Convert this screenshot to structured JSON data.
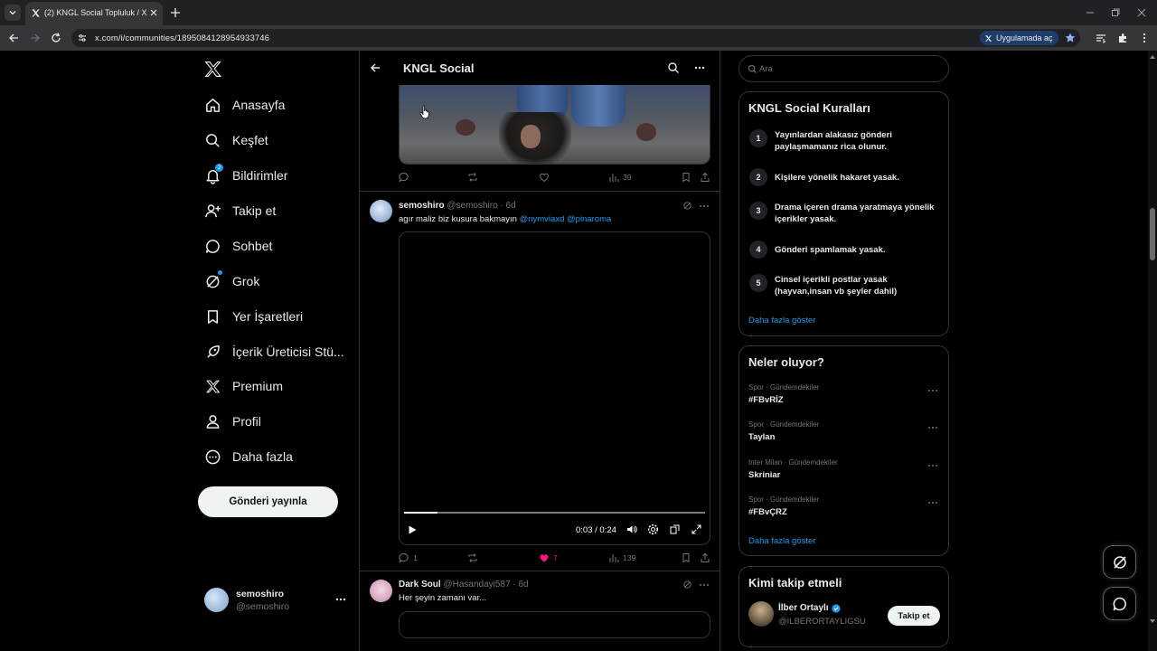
{
  "browser": {
    "tab_title": "(2) KNGL Social Topluluk / X",
    "url": "x.com/i/communities/1895084128954933746",
    "app_open_label": "Uygulamada aç"
  },
  "nav": {
    "items": [
      {
        "label": "Anasayfa",
        "icon": "home-icon"
      },
      {
        "label": "Keşfet",
        "icon": "search-icon"
      },
      {
        "label": "Bildirimler",
        "icon": "bell-icon",
        "badge": "2"
      },
      {
        "label": "Takip et",
        "icon": "add-person-icon"
      },
      {
        "label": "Sohbet",
        "icon": "chat-icon"
      },
      {
        "label": "Grok",
        "icon": "grok-icon"
      },
      {
        "label": "Yer İşaretleri",
        "icon": "bookmark-icon"
      },
      {
        "label": "İçerik Üreticisi Stü...",
        "icon": "rocket-icon"
      },
      {
        "label": "Premium",
        "icon": "x-logo-icon"
      },
      {
        "label": "Profil",
        "icon": "person-icon"
      },
      {
        "label": "Daha fazla",
        "icon": "more-circle-icon"
      }
    ],
    "post_button": "Gönderi yayınla",
    "account": {
      "name": "semoshiro",
      "handle": "@semoshiro"
    }
  },
  "header": {
    "title": "KNGL Social"
  },
  "feed": {
    "top_post_actions": {
      "replies": "",
      "reposts": "",
      "likes": "",
      "views": "39"
    },
    "posts": [
      {
        "name": "semoshiro",
        "handle": "@semoshiro",
        "time": "· 6d",
        "text": "agır maliz biz kusura bakmayın",
        "mentions": [
          "@nymviaxd",
          "@pinaroma"
        ],
        "video": {
          "time": "0:03 / 0:24",
          "progress": 0.11
        },
        "actions": {
          "replies": "1",
          "reposts": "",
          "likes": "7",
          "views": "139"
        }
      },
      {
        "name": "Dark Soul",
        "handle": "@Hasandayi587",
        "time": "· 6d",
        "text": "Her şeyin zamanı var..."
      }
    ]
  },
  "right": {
    "search_placeholder": "Ara",
    "rules": {
      "title": "KNGL Social Kuralları",
      "items": [
        {
          "num": "1",
          "text": "Yayınlardan alakasız gönderi paylaşmamanız rica olunur."
        },
        {
          "num": "2",
          "text": "Kişilere yönelik hakaret yasak."
        },
        {
          "num": "3",
          "text": "Drama içeren drama yaratmaya yönelik içerikler yasak."
        },
        {
          "num": "4",
          "text": "Gönderi spamlamak yasak."
        },
        {
          "num": "5",
          "text": "Cinsel içerikli postlar yasak (hayvan,insan vb şeyler dahil)"
        }
      ],
      "show_more": "Daha fazla göster"
    },
    "trends": {
      "title": "Neler oluyor?",
      "items": [
        {
          "meta": "Spor · Gündemdekiler",
          "name": "#FBvRİZ"
        },
        {
          "meta": "Spor · Gündemdekiler",
          "name": "Taylan"
        },
        {
          "meta": "Inter Milan · Gündemdekiler",
          "name": "Skriniar"
        },
        {
          "meta": "Spor · Gündemdekiler",
          "name": "#FBvÇRZ"
        }
      ],
      "show_more": "Daha fazla göster"
    },
    "who_to_follow": {
      "title": "Kimi takip etmeli",
      "user": {
        "name": "İlber Ortaylı",
        "handle": "@ILBERORTAYLIGSU",
        "button": "Takip et"
      }
    }
  },
  "colors": {
    "accent": "#1d9bf0",
    "like": "#f91880",
    "background": "#000000",
    "border": "#2f3336"
  }
}
